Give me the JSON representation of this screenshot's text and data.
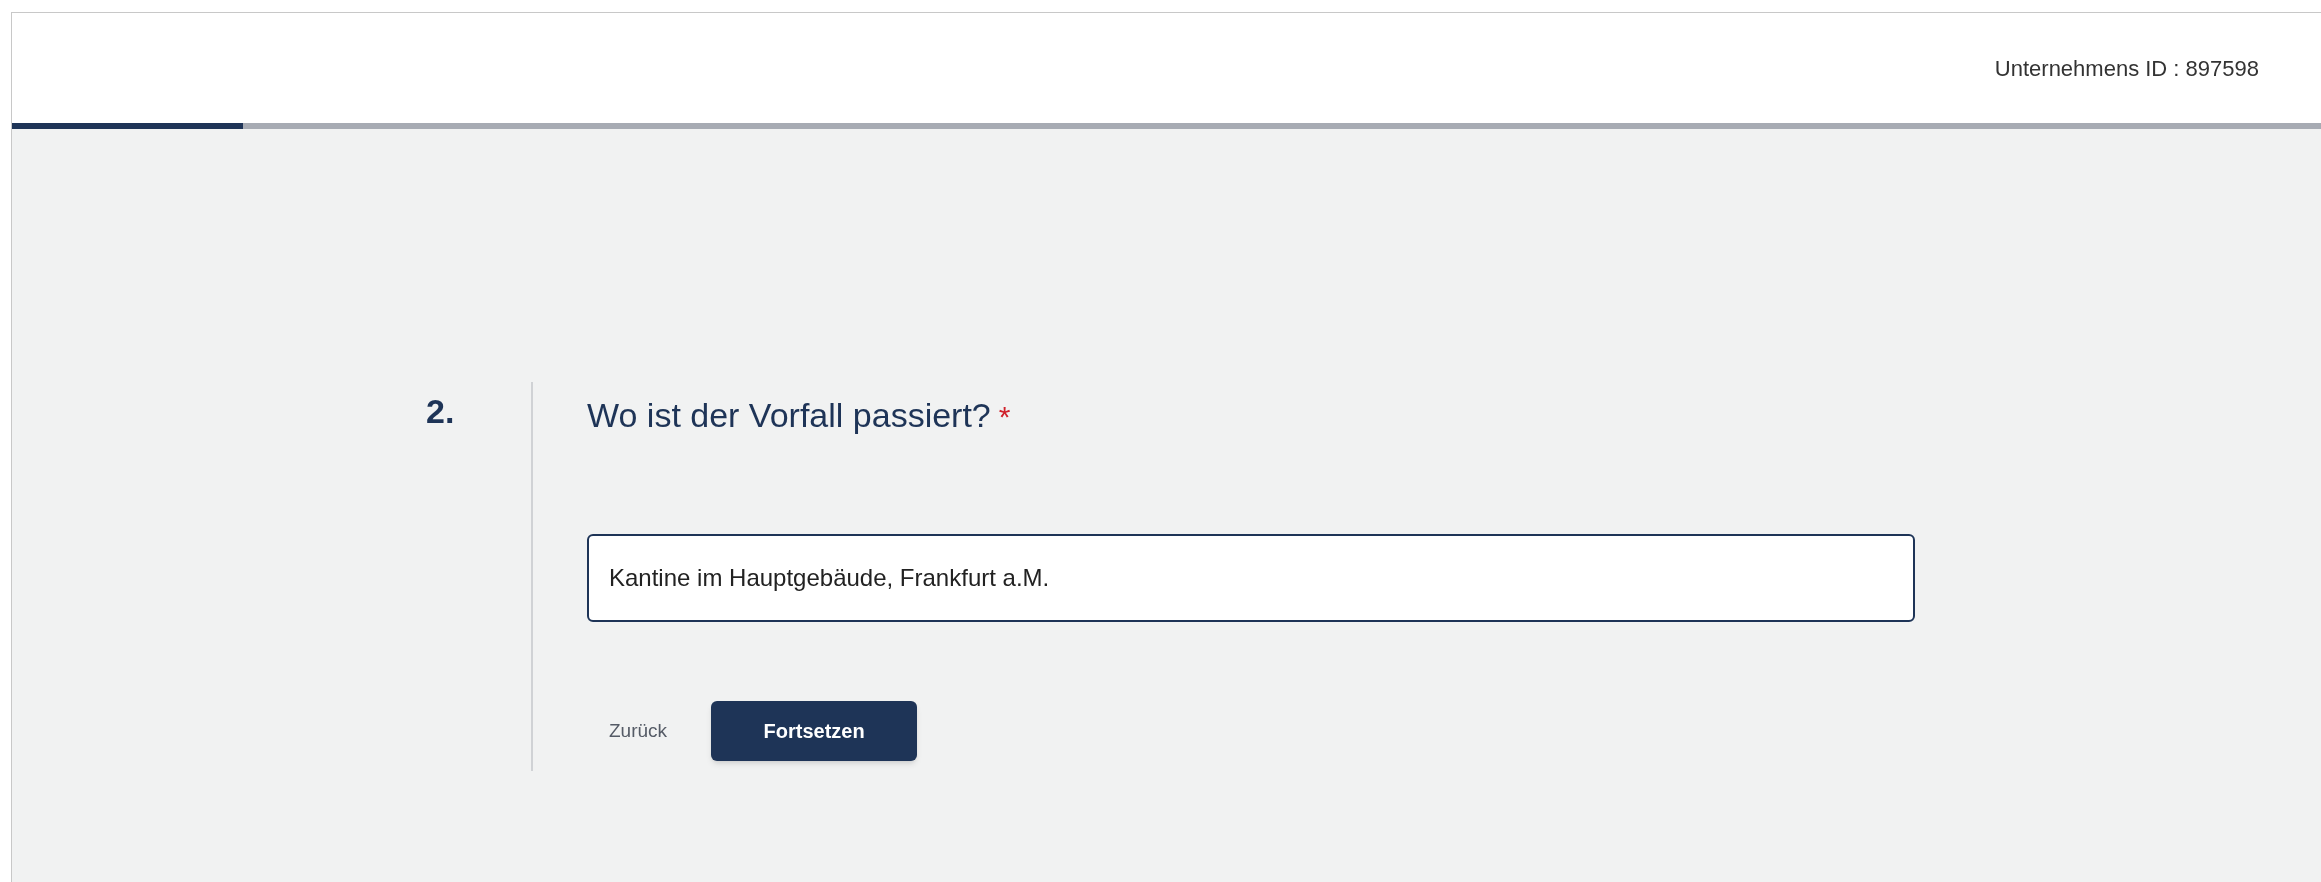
{
  "header": {
    "company_id": "Unternehmens ID : 897598"
  },
  "progress": {
    "level": 0.1
  },
  "question": {
    "number": "2.",
    "title": "Wo ist der Vorfall passiert?",
    "required": true,
    "required_mark": "*",
    "answer": {
      "value": "Kantine im Hauptgebäude, Frankfurt a.M.",
      "focused": true
    }
  },
  "buttons": [
    {
      "label": "Zurück",
      "kind": "secondary"
    },
    {
      "label": "Fortsetzen",
      "kind": "primary"
    }
  ]
}
